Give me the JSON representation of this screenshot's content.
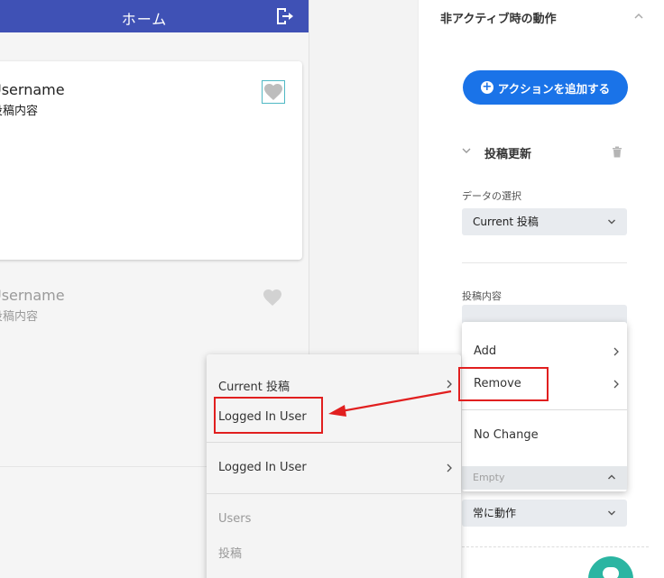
{
  "preview": {
    "app_title": "ホーム",
    "posts": [
      {
        "username": "Username",
        "content": "投稿内容"
      },
      {
        "username": "Username",
        "content": "投稿内容"
      }
    ]
  },
  "panel": {
    "title": "非アクティブ時の動作",
    "add_action_label": "アクションを追加する",
    "section_title": "投稿更新",
    "data_select_label": "データの選択",
    "data_select_value": "Current 投稿",
    "content_label": "投稿内容",
    "trigger_value": "常に動作"
  },
  "menu_right": {
    "items": [
      "Add",
      "Remove",
      "No Change"
    ],
    "empty_label": "Empty"
  },
  "menu_left": {
    "items": [
      "Current 投稿",
      "Logged In User",
      "Logged In User"
    ],
    "section_items": [
      "Users",
      "投稿"
    ]
  },
  "colors": {
    "appbar": "#3f51b5",
    "primary_button": "#1a73e8",
    "highlight": "#e11f1f",
    "chat": "#2bb5a2"
  }
}
